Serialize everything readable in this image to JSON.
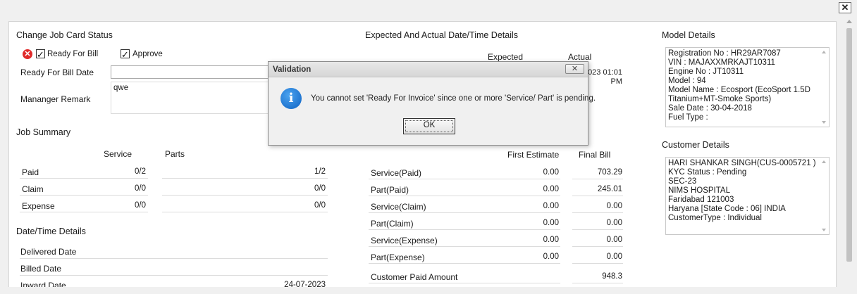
{
  "window": {
    "close_label": "✕"
  },
  "job_card_status": {
    "title": "Change Job Card Status",
    "ready_for_bill_label": "Ready For Bill",
    "ready_for_bill_checked": true,
    "approve_label": "Approve",
    "approve_checked": true,
    "ready_for_bill_date_label": "Ready For Bill Date",
    "ready_for_bill_date_value": "",
    "manager_remark_label": "Mananger Remark",
    "manager_remark_value": "qwe"
  },
  "expected_actual": {
    "title": "Expected And Actual Date/Time Details",
    "col_expected": "Expected",
    "col_actual": "Actual",
    "actual_value_1": "023 01:01",
    "actual_value_2": "PM"
  },
  "job_summary": {
    "title": "Job Summary",
    "col_service": "Service",
    "col_parts": "Parts",
    "rows": [
      {
        "label": "Paid",
        "service": "0/2",
        "parts": "1/2"
      },
      {
        "label": "Claim",
        "service": "0/0",
        "parts": "0/0"
      },
      {
        "label": "Expense",
        "service": "0/0",
        "parts": "0/0"
      }
    ]
  },
  "estimate": {
    "col_first": "First Estimate",
    "col_final": "Final Bill",
    "rows": [
      {
        "label": "Service(Paid)",
        "first": "0.00",
        "final": "703.29"
      },
      {
        "label": "Part(Paid)",
        "first": "0.00",
        "final": "245.01"
      },
      {
        "label": "Service(Claim)",
        "first": "0.00",
        "final": "0.00"
      },
      {
        "label": "Part(Claim)",
        "first": "0.00",
        "final": "0.00"
      },
      {
        "label": "Service(Expense)",
        "first": "0.00",
        "final": "0.00"
      },
      {
        "label": "Part(Expense)",
        "first": "0.00",
        "final": "0.00"
      }
    ],
    "customer_paid_label": "Customer Paid Amount",
    "customer_paid_value": "948.3"
  },
  "datetime_details": {
    "title": "Date/Time Details",
    "rows": [
      {
        "label": "Delivered Date",
        "value": ""
      },
      {
        "label": "Billed Date",
        "value": ""
      },
      {
        "label": "Inward Date",
        "value": "24-07-2023"
      }
    ]
  },
  "model_details": {
    "title": "Model Details",
    "lines": [
      "Registration No : HR29AR7087",
      "VIN : MAJAXXMRKAJT10311",
      "Engine No : JT10311",
      "Model : 94",
      "Model Name : Ecosport (EcoSport 1.5D",
      "Titanium+MT-Smoke Sports)",
      "Sale Date : 30-04-2018",
      "Fuel Type :"
    ]
  },
  "customer_details": {
    "title": "Customer Details",
    "lines": [
      "HARI SHANKAR SINGH(CUS-0005721 )",
      "KYC Status : Pending",
      "SEC-23",
      "NIMS HOSPITAL",
      "Faridabad 121003",
      "Haryana [State Code : 06] INDIA",
      "CustomerType : Individual"
    ]
  },
  "dialog": {
    "title": "Validation",
    "close_label": "✕",
    "icon": "info-icon",
    "message": "You cannot set 'Ready For Invoice' since one or more 'Service/ Part' is pending.",
    "ok_label": "OK"
  }
}
